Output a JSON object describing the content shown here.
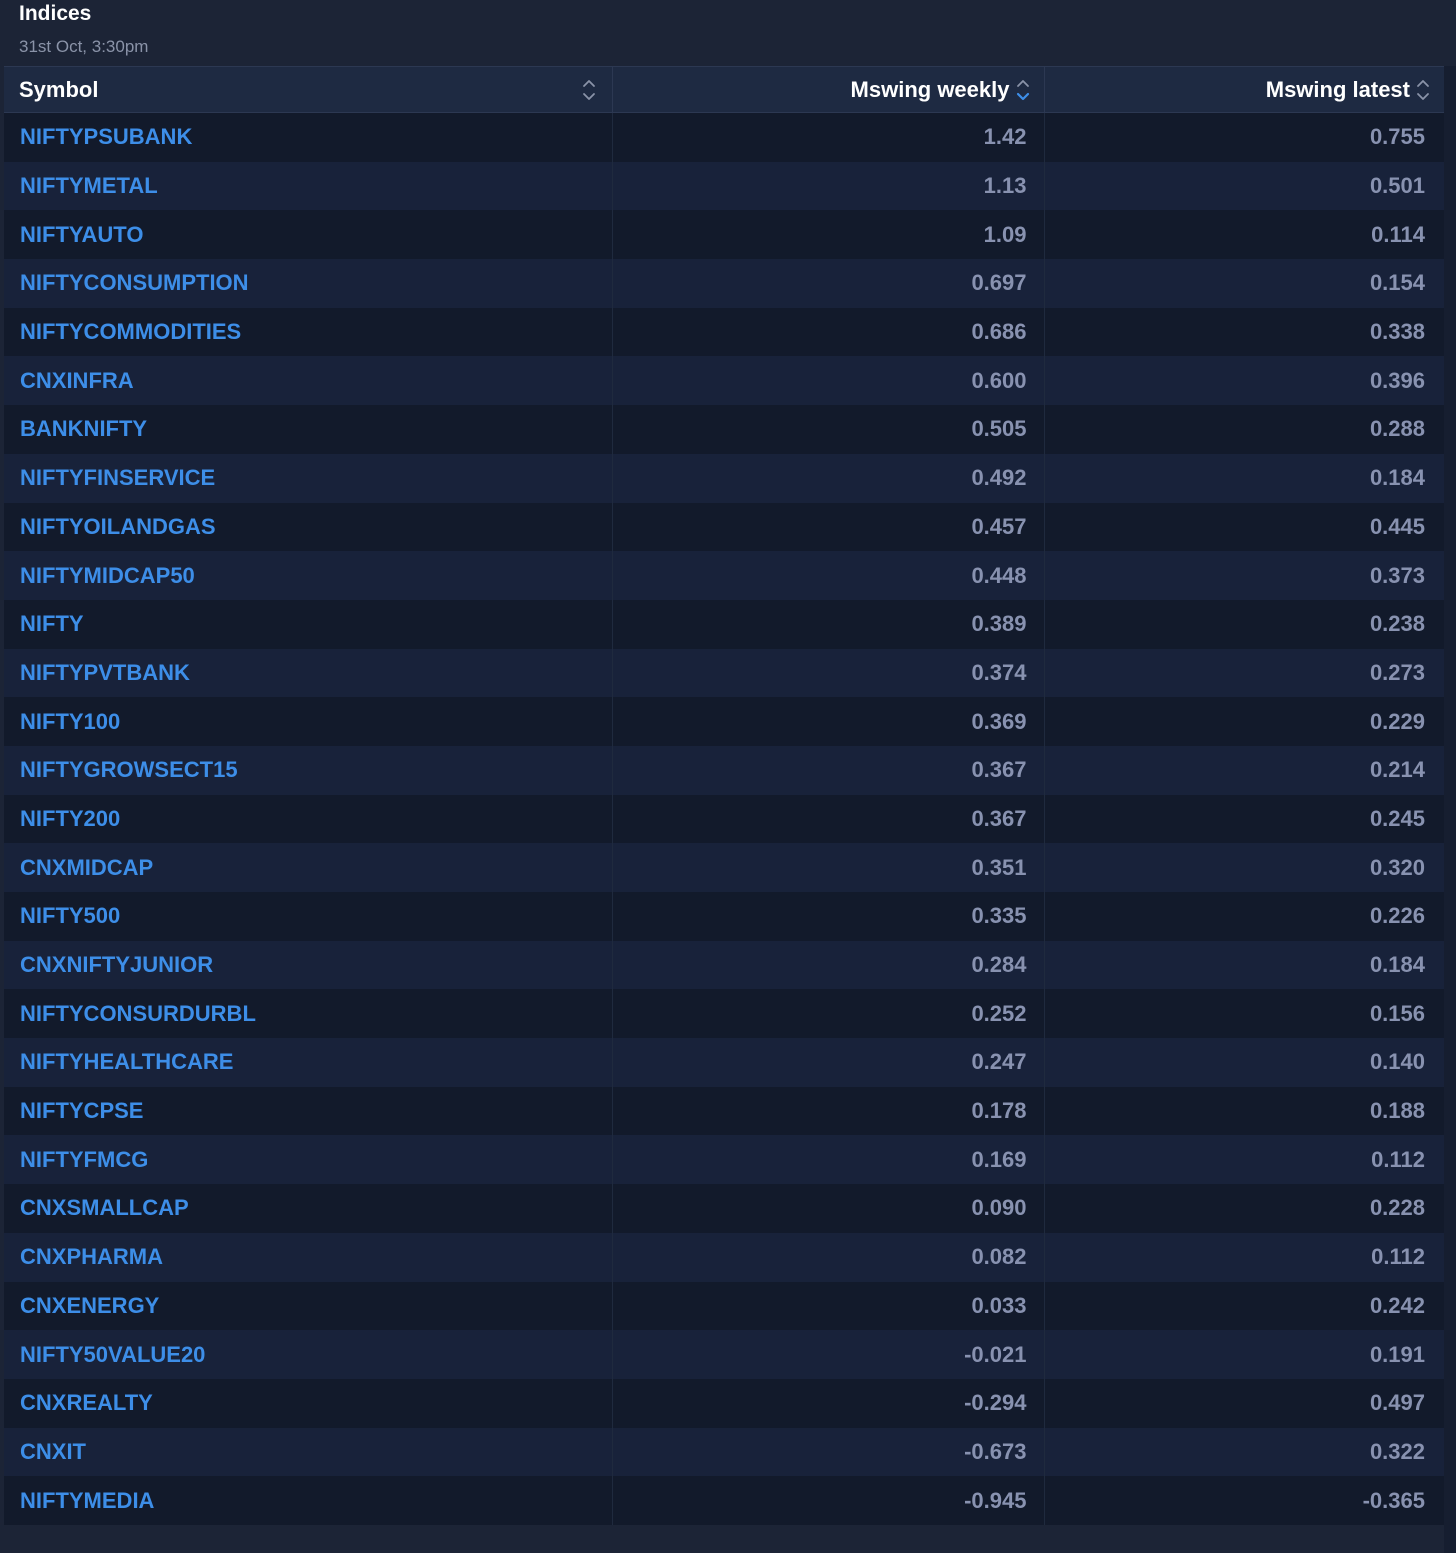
{
  "header": {
    "title": "Indices",
    "timestamp": "31st Oct, 3:30pm"
  },
  "table": {
    "columns": [
      {
        "label": "Symbol",
        "sort": "none"
      },
      {
        "label": "Mswing weekly",
        "sort": "descending"
      },
      {
        "label": "Mswing latest",
        "sort": "none"
      }
    ],
    "rows": [
      [
        "NIFTYPSUBANK",
        "1.42",
        "0.755"
      ],
      [
        "NIFTYMETAL",
        "1.13",
        "0.501"
      ],
      [
        "NIFTYAUTO",
        "1.09",
        "0.114"
      ],
      [
        "NIFTYCONSUMPTION",
        "0.697",
        "0.154"
      ],
      [
        "NIFTYCOMMODITIES",
        "0.686",
        "0.338"
      ],
      [
        "CNXINFRA",
        "0.600",
        "0.396"
      ],
      [
        "BANKNIFTY",
        "0.505",
        "0.288"
      ],
      [
        "NIFTYFINSERVICE",
        "0.492",
        "0.184"
      ],
      [
        "NIFTYOILANDGAS",
        "0.457",
        "0.445"
      ],
      [
        "NIFTYMIDCAP50",
        "0.448",
        "0.373"
      ],
      [
        "NIFTY",
        "0.389",
        "0.238"
      ],
      [
        "NIFTYPVTBANK",
        "0.374",
        "0.273"
      ],
      [
        "NIFTY100",
        "0.369",
        "0.229"
      ],
      [
        "NIFTYGROWSECT15",
        "0.367",
        "0.214"
      ],
      [
        "NIFTY200",
        "0.367",
        "0.245"
      ],
      [
        "CNXMIDCAP",
        "0.351",
        "0.320"
      ],
      [
        "NIFTY500",
        "0.335",
        "0.226"
      ],
      [
        "CNXNIFTYJUNIOR",
        "0.284",
        "0.184"
      ],
      [
        "NIFTYCONSURDURBL",
        "0.252",
        "0.156"
      ],
      [
        "NIFTYHEALTHCARE",
        "0.247",
        "0.140"
      ],
      [
        "NIFTYCPSE",
        "0.178",
        "0.188"
      ],
      [
        "NIFTYFMCG",
        "0.169",
        "0.112"
      ],
      [
        "CNXSMALLCAP",
        "0.090",
        "0.228"
      ],
      [
        "CNXPHARMA",
        "0.082",
        "0.112"
      ],
      [
        "CNXENERGY",
        "0.033",
        "0.242"
      ],
      [
        "NIFTY50VALUE20",
        "-0.021",
        "0.191"
      ],
      [
        "CNXREALTY",
        "-0.294",
        "0.497"
      ],
      [
        "CNXIT",
        "-0.673",
        "0.322"
      ],
      [
        "NIFTYMEDIA",
        "-0.945",
        "-0.365"
      ]
    ]
  },
  "colors": {
    "background": "#1c2436",
    "header_row": "#1e2a42",
    "row_odd": "#121a2b",
    "row_even": "#18223a",
    "symbol_link": "#3d8ee8",
    "value_text": "#8892b0",
    "sort_active": "#3d8ee8",
    "sort_inactive": "#8a93a8"
  },
  "icons": {
    "sort_unsorted": "chevron-up-down-icon",
    "sort_descending": "sort-descending-icon"
  }
}
